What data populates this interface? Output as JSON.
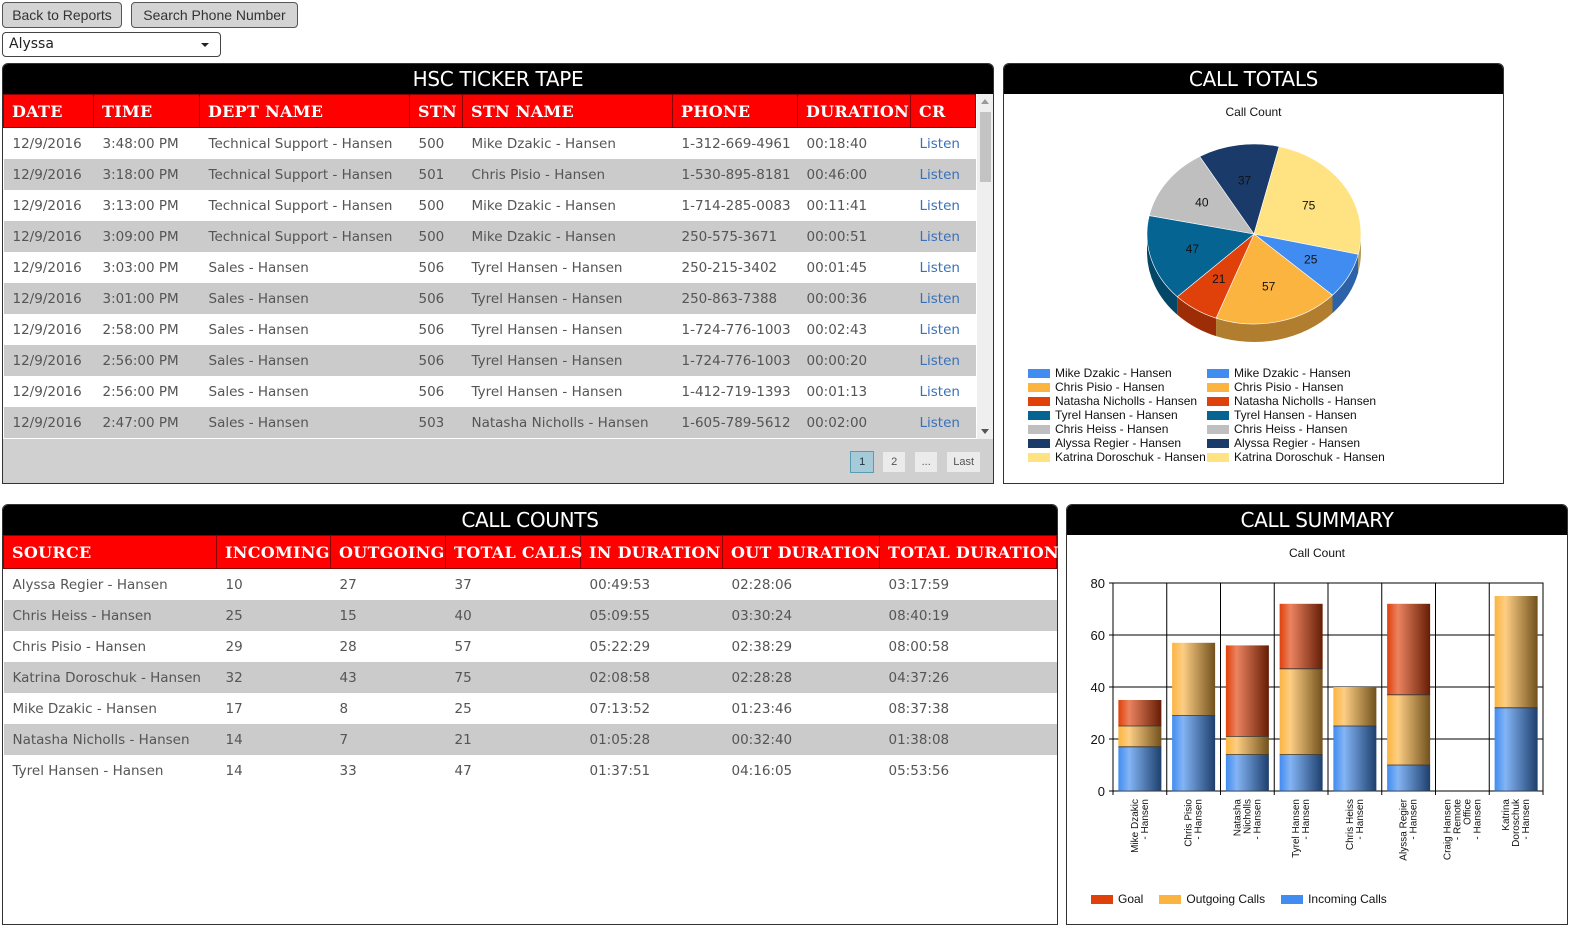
{
  "toolbar": {
    "back_label": "Back to Reports",
    "search_label": "Search Phone Number",
    "user_select_value": "Alyssa"
  },
  "ticker": {
    "title": "HSC TICKER TAPE",
    "columns": [
      "DATE",
      "TIME",
      "DEPT NAME",
      "STN",
      "STN NAME",
      "PHONE",
      "DURATION",
      "CR"
    ],
    "rows": [
      [
        "12/9/2016",
        "3:48:00 PM",
        "Technical Support - Hansen",
        "500",
        "Mike Dzakic - Hansen",
        "1-312-669-4961",
        "00:18:40",
        "Listen"
      ],
      [
        "12/9/2016",
        "3:18:00 PM",
        "Technical Support - Hansen",
        "501",
        "Chris Pisio - Hansen",
        "1-530-895-8181",
        "00:46:00",
        "Listen"
      ],
      [
        "12/9/2016",
        "3:13:00 PM",
        "Technical Support - Hansen",
        "500",
        "Mike Dzakic - Hansen",
        "1-714-285-0083",
        "00:11:41",
        "Listen"
      ],
      [
        "12/9/2016",
        "3:09:00 PM",
        "Technical Support - Hansen",
        "500",
        "Mike Dzakic - Hansen",
        "250-575-3671",
        "00:00:51",
        "Listen"
      ],
      [
        "12/9/2016",
        "3:03:00 PM",
        "Sales - Hansen",
        "506",
        "Tyrel Hansen - Hansen",
        "250-215-3402",
        "00:01:45",
        "Listen"
      ],
      [
        "12/9/2016",
        "3:01:00 PM",
        "Sales - Hansen",
        "506",
        "Tyrel Hansen - Hansen",
        "250-863-7388",
        "00:00:36",
        "Listen"
      ],
      [
        "12/9/2016",
        "2:58:00 PM",
        "Sales - Hansen",
        "506",
        "Tyrel Hansen - Hansen",
        "1-724-776-1003",
        "00:02:43",
        "Listen"
      ],
      [
        "12/9/2016",
        "2:56:00 PM",
        "Sales - Hansen",
        "506",
        "Tyrel Hansen - Hansen",
        "1-724-776-1003",
        "00:00:20",
        "Listen"
      ],
      [
        "12/9/2016",
        "2:56:00 PM",
        "Sales - Hansen",
        "506",
        "Tyrel Hansen - Hansen",
        "1-412-719-1393",
        "00:01:13",
        "Listen"
      ],
      [
        "12/9/2016",
        "2:47:00 PM",
        "Sales - Hansen",
        "503",
        "Natasha Nicholls - Hansen",
        "1-605-789-5612",
        "00:02:00",
        "Listen"
      ]
    ],
    "pager": [
      "1",
      "2",
      "...",
      "Last"
    ],
    "current_page": "1"
  },
  "call_counts": {
    "title": "CALL COUNTS",
    "columns": [
      "SOURCE",
      "INCOMING",
      "OUTGOING",
      "TOTAL CALLS",
      "IN DURATION",
      "OUT DURATION",
      "TOTAL DURATION"
    ],
    "rows": [
      [
        "Alyssa Regier - Hansen",
        "10",
        "27",
        "37",
        "00:49:53",
        "02:28:06",
        "03:17:59"
      ],
      [
        "Chris Heiss - Hansen",
        "25",
        "15",
        "40",
        "05:09:55",
        "03:30:24",
        "08:40:19"
      ],
      [
        "Chris Pisio - Hansen",
        "29",
        "28",
        "57",
        "05:22:29",
        "02:38:29",
        "08:00:58"
      ],
      [
        "Katrina Doroschuk - Hansen",
        "32",
        "43",
        "75",
        "02:08:58",
        "02:28:28",
        "04:37:26"
      ],
      [
        "Mike Dzakic - Hansen",
        "17",
        "8",
        "25",
        "07:13:52",
        "01:23:46",
        "08:37:38"
      ],
      [
        "Natasha Nicholls - Hansen",
        "14",
        "7",
        "21",
        "01:05:28",
        "00:32:40",
        "01:38:08"
      ],
      [
        "Tyrel Hansen - Hansen",
        "14",
        "33",
        "47",
        "01:37:51",
        "04:16:05",
        "05:53:56"
      ]
    ]
  },
  "call_totals": {
    "title": "CALL TOTALS"
  },
  "call_summary": {
    "title": "CALL SUMMARY"
  },
  "chart_data": [
    {
      "type": "pie",
      "title": "Call Count",
      "labels": [
        "Mike Dzakic - Hansen",
        "Chris Pisio - Hansen",
        "Natasha Nicholls - Hansen",
        "Tyrel Hansen - Hansen",
        "Chris Heiss - Hansen",
        "Alyssa Regier - Hansen",
        "Katrina Doroschuk - Hansen"
      ],
      "values": [
        25,
        57,
        21,
        47,
        40,
        37,
        75
      ],
      "colors": [
        "#418CF0",
        "#FCB441",
        "#E0400A",
        "#056492",
        "#BFBFBF",
        "#1A3B69",
        "#FFE382"
      ],
      "legend_entries": [
        "Mike Dzakic - Hansen",
        "Chris Pisio - Hansen",
        "Natasha Nicholls - Hansen",
        "Tyrel Hansen - Hansen",
        "Chris Heiss - Hansen",
        "Alyssa Regier - Hansen",
        "Katrina Doroschuk - Hansen",
        "Mike Dzakic - Hansen",
        "Chris Pisio - Hansen",
        "Natasha Nicholls - Hansen",
        "Tyrel Hansen - Hansen",
        "Chris Heiss - Hansen",
        "Alyssa Regier - Hansen",
        "Katrina Doroschuk - Hansen"
      ],
      "legend_placement": "bottom"
    },
    {
      "type": "bar",
      "stacked": true,
      "title": "Call Count",
      "categories": [
        "Mike Dzakic - Hansen",
        "Chris Pisio - Hansen",
        "Natasha Nicholls - Hansen",
        "Tyrel Hansen - Hansen",
        "Chris Heiss - Hansen",
        "Alyssa Regier - Hansen",
        "Craig Hansen - Remote Office - Hansen",
        "Katrina Doroschuk - Hansen"
      ],
      "category_label_lines": [
        [
          "Mike Dzakic",
          "- Hansen"
        ],
        [
          "Chris Pisio",
          "- Hansen"
        ],
        [
          "Natasha",
          "Nicholls",
          "- Hansen"
        ],
        [
          "Tyrel Hansen",
          "- Hansen"
        ],
        [
          "Chris Heiss",
          "- Hansen"
        ],
        [
          "Alyssa Regier",
          "- Hansen"
        ],
        [
          "Craig Hansen",
          "- Remote",
          "Office",
          "- Hansen"
        ],
        [
          "Katrina",
          "Doroschuk",
          "- Hansen"
        ]
      ],
      "series": [
        {
          "name": "Incoming Calls",
          "color": "#418CF0",
          "values": [
            17,
            29,
            14,
            14,
            25,
            10,
            0,
            32
          ]
        },
        {
          "name": "Outgoing Calls",
          "color": "#FCB441",
          "values": [
            8,
            28,
            7,
            33,
            15,
            27,
            0,
            43
          ]
        },
        {
          "name": "Goal",
          "color": "#E0400A",
          "values": [
            10,
            0,
            35,
            25,
            0,
            35,
            0,
            0
          ]
        }
      ],
      "legend_order": [
        "Goal",
        "Outgoing Calls",
        "Incoming Calls"
      ],
      "yticks": [
        0,
        20,
        40,
        60,
        80
      ],
      "ylim": [
        0,
        80
      ],
      "grid": true,
      "xlabel": "",
      "ylabel": "",
      "legend_placement": "bottom"
    }
  ]
}
